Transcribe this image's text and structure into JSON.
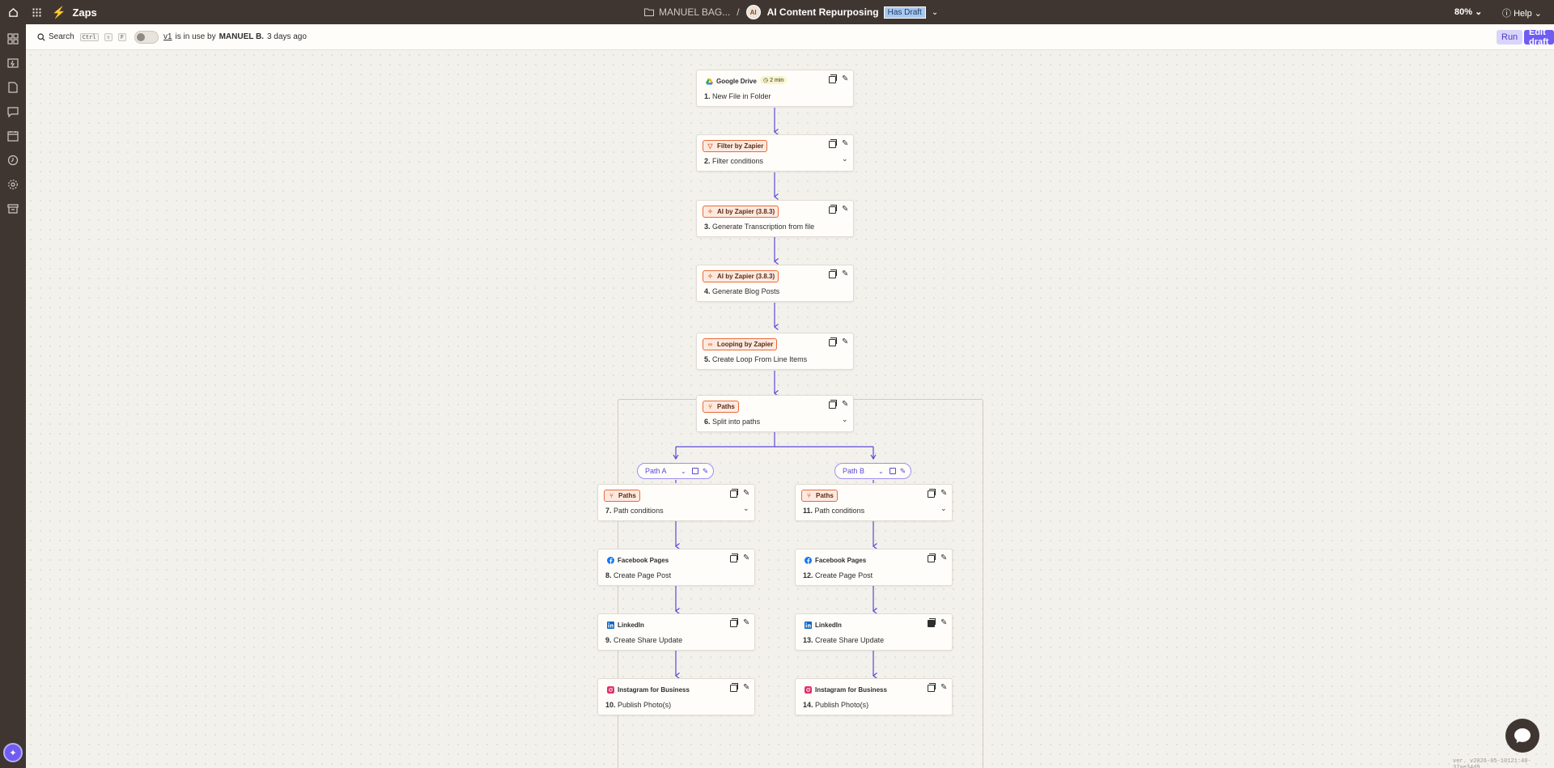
{
  "topbar": {
    "app_name": "Zaps",
    "folder": "MANUEL BAG...",
    "separator": "/",
    "zap_name": "AI Content Repurposing",
    "draft_badge": "Has Draft",
    "zoom": "80%",
    "help": "Help"
  },
  "toolbar": {
    "search_label": "Search",
    "shortcut_ctrl": "Ctrl",
    "shortcut_shift": "⇧",
    "shortcut_f": "F",
    "version": "v1",
    "in_use_text": "is in use by",
    "user": "MANUEL B.",
    "when": "3 days ago",
    "run_label": "Run",
    "edit_draft_label": "Edit draft"
  },
  "sidebar": {
    "icons": [
      "apps-icon",
      "zap-icon",
      "tables-icon",
      "interfaces-icon",
      "calendar-icon",
      "history-icon",
      "settings-icon",
      "archive-icon"
    ]
  },
  "colors": {
    "topbar_bg": "#403631",
    "accent": "#6f5cf0",
    "connector": "#5a4bd6",
    "zapier_orange": "#ff4f00"
  },
  "steps": [
    {
      "app": "Google Drive",
      "num": "1.",
      "action": "New File in Folder",
      "icon": "google-drive-icon",
      "badge": "2 min",
      "style": "plain"
    },
    {
      "app": "Filter by Zapier",
      "num": "2.",
      "action": "Filter conditions",
      "icon": "filter-icon",
      "style": "orange",
      "expandable": true
    },
    {
      "app": "AI by Zapier (3.8.3)",
      "num": "3.",
      "action": "Generate Transcription from file",
      "icon": "ai-sparkle-icon",
      "style": "orange"
    },
    {
      "app": "AI by Zapier (3.8.3)",
      "num": "4.",
      "action": "Generate Blog Posts",
      "icon": "ai-sparkle-icon",
      "style": "orange"
    },
    {
      "app": "Looping by Zapier",
      "num": "5.",
      "action": "Create Loop From Line Items",
      "icon": "loop-icon",
      "style": "orange"
    },
    {
      "app": "Paths",
      "num": "6.",
      "action": "Split into paths",
      "icon": "paths-icon",
      "style": "orange",
      "expandable": true
    },
    {
      "app": "Paths",
      "num": "7.",
      "action": "Path conditions",
      "icon": "paths-icon",
      "style": "orange",
      "expandable": true
    },
    {
      "app": "Facebook Pages",
      "num": "8.",
      "action": "Create Page Post",
      "icon": "facebook-icon",
      "style": "plain"
    },
    {
      "app": "LinkedIn",
      "num": "9.",
      "action": "Create Share Update",
      "icon": "linkedin-icon",
      "style": "plain"
    },
    {
      "app": "Instagram for Business",
      "num": "10.",
      "action": "Publish Photo(s)",
      "icon": "instagram-icon",
      "style": "plain"
    },
    {
      "app": "Paths",
      "num": "11.",
      "action": "Path conditions",
      "icon": "paths-icon",
      "style": "orange",
      "expandable": true
    },
    {
      "app": "Facebook Pages",
      "num": "12.",
      "action": "Create Page Post",
      "icon": "facebook-icon",
      "style": "plain"
    },
    {
      "app": "LinkedIn",
      "num": "13.",
      "action": "Create Share Update",
      "icon": "linkedin-icon",
      "style": "plain"
    },
    {
      "app": "Instagram for Business",
      "num": "14.",
      "action": "Publish Photo(s)",
      "icon": "instagram-icon",
      "style": "plain"
    }
  ],
  "paths": [
    {
      "label": "Path A"
    },
    {
      "label": "Path B"
    }
  ],
  "footer": {
    "version_info": "ver. v2026-05-10121:40-37ae34d9"
  }
}
